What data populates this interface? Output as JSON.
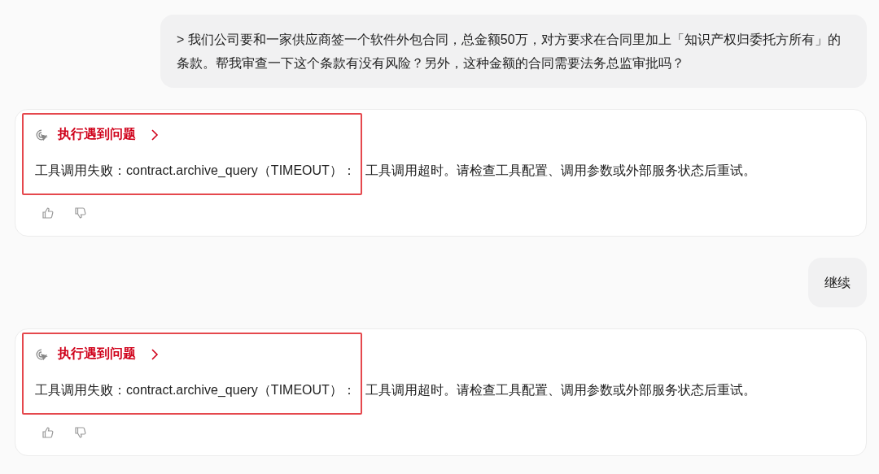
{
  "messages": [
    {
      "kind": "user",
      "text": "> 我们公司要和一家供应商签一个软件外包合同，总金额50万，对方要求在合同里加上「知识产权归委托方所有」的条款。帮我审查一下这个条款有没有风险？另外，这种金额的合同需要法务总监审批吗？"
    },
    {
      "kind": "assistant",
      "status": "执行遇到问题",
      "error_head": "工具调用失败：contract.archive_query（TIMEOUT）：",
      "error_tail": "工具调用超时。请检查工具配置、调用参数或外部服务状态后重试。",
      "highlighted": true
    },
    {
      "kind": "user",
      "text": "继续"
    },
    {
      "kind": "assistant",
      "status": "执行遇到问题",
      "error_head": "工具调用失败：contract.archive_query（TIMEOUT）：",
      "error_tail": "工具调用超时。请检查工具配置、调用参数或外部服务状态后重试。",
      "highlighted": true
    }
  ]
}
